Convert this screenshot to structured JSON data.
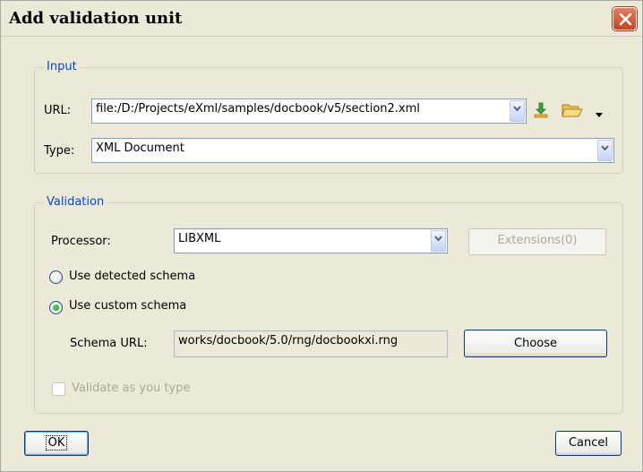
{
  "window": {
    "title": "Add validation unit"
  },
  "input_group": {
    "legend": "Input",
    "url_label": "URL:",
    "url_value": "file:/D:/Projects/eXml/samples/docbook/v5/section2.xml",
    "type_label": "Type:",
    "type_value": "XML Document"
  },
  "validation_group": {
    "legend": "Validation",
    "processor_label": "Processor:",
    "processor_value": "LIBXML",
    "extensions_label": "Extensions(0)",
    "radio_detected": {
      "label": "Use detected schema",
      "checked": false
    },
    "radio_custom": {
      "label": "Use custom schema",
      "checked": true
    },
    "schema_url_label": "Schema URL:",
    "schema_url_value": "works/docbook/5.0/rng/docbookxi.rng",
    "choose_label": "Choose",
    "validate_as_you_type": {
      "label": "Validate as you type",
      "checked": false,
      "enabled": false
    }
  },
  "footer": {
    "ok_label": "OK",
    "cancel_label": "Cancel"
  },
  "colors": {
    "legend": "#0046d5",
    "close_button": "#c3441f",
    "background": "#ece9d8"
  },
  "icons": [
    "close-icon",
    "download-icon",
    "folder-open-icon",
    "dropdown-arrow-icon"
  ]
}
